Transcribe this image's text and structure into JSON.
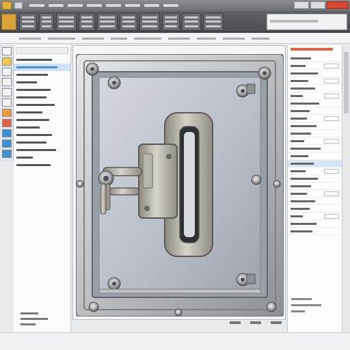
{
  "window": {
    "title": "",
    "controls": [
      "minimize",
      "maximize",
      "close"
    ],
    "close_color": "#d9462f"
  },
  "ribbon": {
    "app_menu_icon": "app-menu-icon",
    "group_count": 11,
    "search_placeholder": ""
  },
  "left_toolstrip": {
    "tools": [
      {
        "icon": "select-icon",
        "color": "#f4f4f4"
      },
      {
        "icon": "folder-icon",
        "color": "#efc94a"
      },
      {
        "icon": "layer-icon",
        "color": "#f4f4f4"
      },
      {
        "icon": "sketch-icon",
        "color": "#f4f4f4"
      },
      {
        "icon": "dimension-icon",
        "color": "#f4f4f4"
      },
      {
        "icon": "constraint-icon",
        "color": "#f4f4f4"
      },
      {
        "icon": "feature-icon",
        "color": "#e89a3c"
      },
      {
        "icon": "fillet-icon",
        "color": "#e2603f"
      },
      {
        "icon": "assembly-icon",
        "color": "#3c8fd4"
      },
      {
        "icon": "mate-icon",
        "color": "#3c8fd4"
      },
      {
        "icon": "pattern-icon",
        "color": "#3c8fd4"
      }
    ]
  },
  "left_panel": {
    "selected_row": 1
  },
  "canvas": {
    "model_name": "",
    "background": "#f6f6f7",
    "plate_color": "#b9bdc4",
    "frame_color": "#8e9196",
    "handle_color": "#a7a49c"
  },
  "right_panel": {
    "accent": "#e0623c",
    "selected_row": 14
  },
  "status": {
    "coords": [
      "",
      "",
      ""
    ]
  }
}
